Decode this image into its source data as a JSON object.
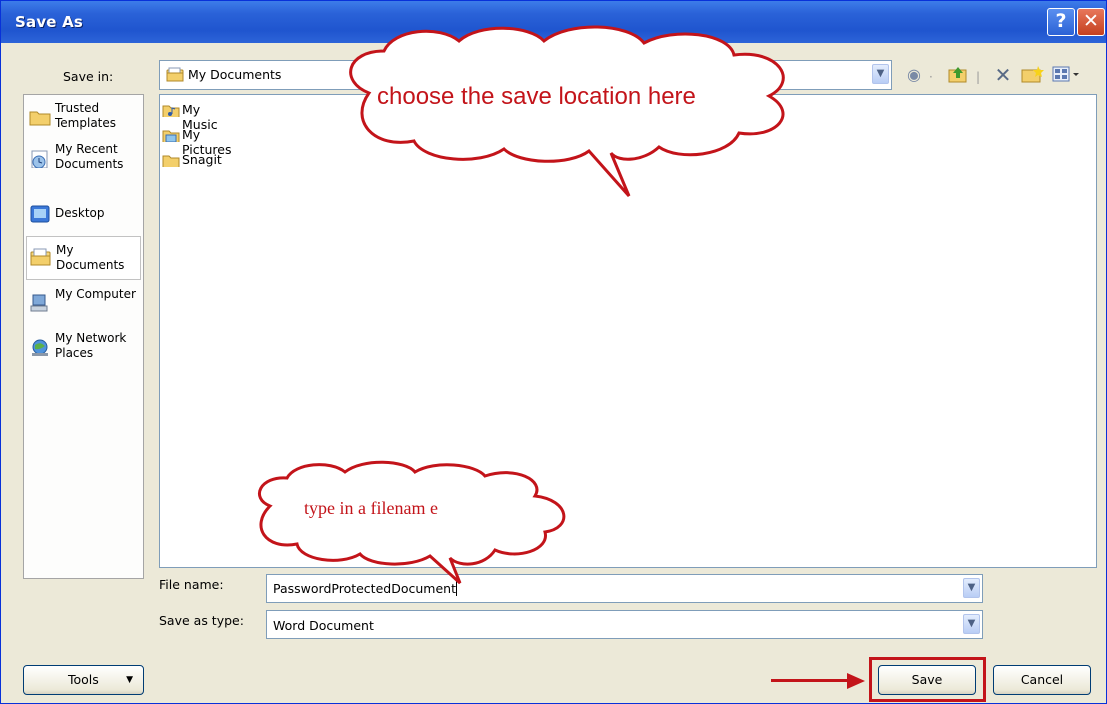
{
  "window": {
    "title": "Save As"
  },
  "titlebar": {
    "help_glyph": "?",
    "close_glyph": "✕"
  },
  "save_in": {
    "label": "Save in:",
    "value": "My Documents"
  },
  "places": [
    {
      "label": "Trusted Templates",
      "icon": "folder-icon"
    },
    {
      "label": "My Recent Documents",
      "icon": "recent-documents-icon"
    },
    {
      "label": "Desktop",
      "icon": "desktop-icon"
    },
    {
      "label": "My Documents",
      "icon": "my-documents-icon"
    },
    {
      "label": "My Computer",
      "icon": "my-computer-icon"
    },
    {
      "label": "My Network Places",
      "icon": "network-places-icon"
    }
  ],
  "files": [
    {
      "name": "My Music",
      "icon": "music-folder-icon"
    },
    {
      "name": "My Pictures",
      "icon": "pictures-folder-icon"
    },
    {
      "name": "Snagit",
      "icon": "folder-icon"
    }
  ],
  "file_name": {
    "label": "File name:",
    "value": "PasswordProtectedDocument"
  },
  "save_as_type": {
    "label": "Save as type:",
    "value": "Word Document"
  },
  "buttons": {
    "tools": "Tools",
    "save": "Save",
    "cancel": "Cancel"
  },
  "annotations": {
    "location_callout": "choose the save location here",
    "filename_callout": "type in a filenam e"
  },
  "colors": {
    "callout_red": "#c3141a",
    "title_blue": "#2a62d8"
  }
}
